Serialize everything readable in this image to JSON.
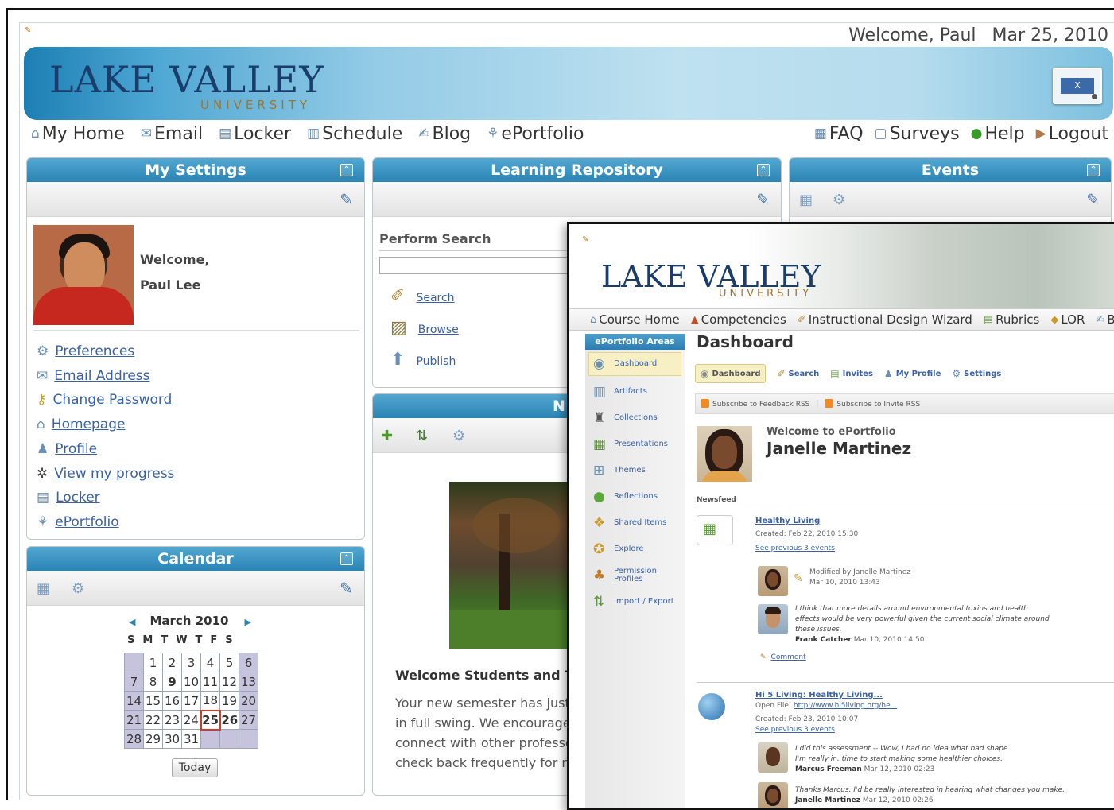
{
  "header": {
    "welcome": "Welcome, Paul",
    "date": "Mar 25, 2010",
    "logo_main": "LAKE VALLEY",
    "logo_sub": "UNIVERSITY"
  },
  "nav_left": [
    {
      "label": "My Home",
      "icon": "home-icon"
    },
    {
      "label": "Email",
      "icon": "email-icon"
    },
    {
      "label": "Locker",
      "icon": "locker-icon"
    },
    {
      "label": "Schedule",
      "icon": "schedule-icon"
    },
    {
      "label": "Blog",
      "icon": "blog-icon"
    },
    {
      "label": "ePortfolio",
      "icon": "eportfolio-icon"
    }
  ],
  "nav_right": [
    {
      "label": "FAQ",
      "icon": "faq-icon"
    },
    {
      "label": "Surveys",
      "icon": "surveys-icon"
    },
    {
      "label": "Help",
      "icon": "help-icon"
    },
    {
      "label": "Logout",
      "icon": "logout-icon"
    }
  ],
  "settings": {
    "title": "My Settings",
    "welcome": "Welcome,",
    "name": "Paul Lee",
    "links": [
      "Preferences",
      "Email Address",
      "Change Password",
      "Homepage",
      "Profile",
      "View my progress",
      "Locker",
      "ePortfolio"
    ]
  },
  "calendar": {
    "title": "Calendar",
    "month": "March 2010",
    "days": [
      "S",
      "M",
      "T",
      "W",
      "T",
      "F",
      "S"
    ],
    "weeks": [
      [
        "",
        "1",
        "2",
        "3",
        "4",
        "5",
        "6"
      ],
      [
        "7",
        "8",
        "9",
        "10",
        "11",
        "12",
        "13"
      ],
      [
        "14",
        "15",
        "16",
        "17",
        "18",
        "19",
        "20"
      ],
      [
        "21",
        "22",
        "23",
        "24",
        "25",
        "26",
        "27"
      ],
      [
        "28",
        "29",
        "30",
        "31",
        "",
        "",
        ""
      ]
    ],
    "today_button": "Today"
  },
  "repository": {
    "title": "Learning Repository",
    "perform_search": "Perform Search",
    "search_placeholder": "",
    "actions": [
      "Search",
      "Browse",
      "Publish"
    ]
  },
  "events": {
    "title": "Events"
  },
  "news": {
    "title_partial": "N",
    "welcome_title": "Welcome Students and T",
    "body": [
      "Your new semester has just",
      "in full swing. We encourage",
      "connect with other professo",
      "check back frequently for n"
    ]
  },
  "overlay": {
    "logo_main": "LAKE VALLEY",
    "logo_sub": "UNIVERSITY",
    "nav": [
      "Course Home",
      "Competencies",
      "Instructional Design Wizard",
      "Rubrics",
      "LOR",
      "B"
    ],
    "sidebar_title": "ePortfolio Areas",
    "sidebar": [
      "Dashboard",
      "Artifacts",
      "Collections",
      "Presentations",
      "Themes",
      "Reflections",
      "Shared Items",
      "Explore",
      "Permission Profiles",
      "Import / Export"
    ],
    "dashboard_title": "Dashboard",
    "tabs": [
      "Dashboard",
      "Search",
      "Invites",
      "My Profile",
      "Settings"
    ],
    "rss": [
      "Subscribe to Feedback RSS",
      "Subscribe to Invite RSS"
    ],
    "welcome": "Welcome to ePortfolio",
    "user_name": "Janelle Martinez",
    "newsfeed": "Newsfeed",
    "feed1": {
      "title": "Healthy Living",
      "created": "Created: Feb 22, 2010 15:30",
      "see_previous": "See previous 3 events",
      "modified_by": "Modified by Janelle Martinez",
      "modified_date": "Mar 10, 2010 13:43",
      "note1": "I think that more details around environmental toxins and health",
      "note2": "effects would be very powerful given the current social climate around",
      "note3": "these issues.",
      "author": "Frank Catcher",
      "author_date": "Mar 10, 2010 14:50",
      "comment": "Comment"
    },
    "feed2": {
      "title": "Hi 5 Living: Healthy Living...",
      "open_file": "Open File:",
      "file_link": "http://www.hi5living.org/he...",
      "created": "Created: Feb 23, 2010 10:07",
      "see_previous": "See previous 3 events",
      "note1": "I did this assessment -- Wow, I had no idea what bad shape",
      "note2": "I'm really in. time to start making some healthier choices.",
      "author": "Marcus Freeman",
      "author_date": "Mar 12, 2010 02:23",
      "note3": "Thanks Marcus. I'd be really interested in hearing what changes you make.",
      "author2": "Janelle Martinez",
      "author2_date": "Mar 12, 2010 02:26"
    }
  }
}
